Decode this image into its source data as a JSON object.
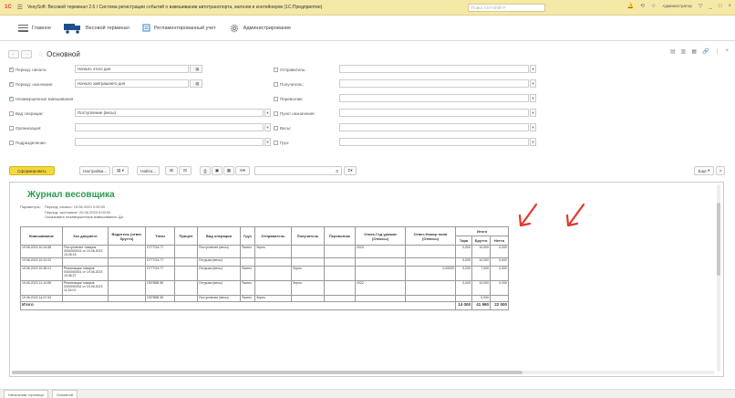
{
  "titlebar": {
    "logo": "1С",
    "title": "VesySoft: Весовой терминал 2.6 / Система регистрации событий о взвешивании автотранспорта, вагонов и контейнеров (1С:Предприятие)",
    "search_placeholder": "Поиск Ctrl+Shift+F",
    "user": "Администратор"
  },
  "nav": {
    "items": [
      {
        "label": "Главное",
        "icon": "menu-icon"
      },
      {
        "label": "Весовой терминал",
        "icon": "truck-icon"
      },
      {
        "label": "Регламентированный учет",
        "icon": "ledger-icon"
      },
      {
        "label": "Администрирование",
        "icon": "gear-icon"
      }
    ]
  },
  "window": {
    "title": "Основной"
  },
  "form": {
    "left": [
      {
        "label": "Период: начало:",
        "checked": true,
        "value": "Начало этого дня"
      },
      {
        "label": "Период: окончание:",
        "checked": true,
        "value": "Начало завтрашнего дня"
      },
      {
        "label": "Незавершенные взвешивания",
        "checked": true,
        "value": ""
      },
      {
        "label": "Вид операции:",
        "checked": false,
        "value": "Поступление (весы)"
      },
      {
        "label": "Организация:",
        "checked": false,
        "value": ""
      },
      {
        "label": "Подразделение:",
        "checked": false,
        "value": ""
      }
    ],
    "right": [
      {
        "label": "Отправитель:",
        "checked": false
      },
      {
        "label": "Получатель:",
        "checked": false
      },
      {
        "label": "Перевозчик:",
        "checked": false
      },
      {
        "label": "Пункт назначения:",
        "checked": false
      },
      {
        "label": "Весы:",
        "checked": false
      },
      {
        "label": "Груз:",
        "checked": false
      }
    ]
  },
  "toolbar": {
    "generate": "Сформировать",
    "settings": "Настройки...",
    "find": "Найти...",
    "sum_value": "0",
    "more": "Еще"
  },
  "report": {
    "title": "Журнал весовщика",
    "params_label": "Параметры:",
    "params": [
      "Период: начало: 19.06.2023 0:00:00",
      "Период: окончание: 20.06.2023 0:00:00",
      "Показывать незавершенные взвешивания: Да"
    ],
    "headers": [
      "Взвешивание",
      "Хоз документ",
      "Водитель (отвес брутто)",
      "Тягач",
      "Прицеп",
      "Вид операции",
      "Груз",
      "Отправитель",
      "Получатель",
      "Перевозчик",
      "Отвес.Год урожая (Отвесы)",
      "Отвес.Номер поля (Отвесы)",
      "Итого"
    ],
    "subheaders": [
      "Тара",
      "Брутто",
      "Нетто"
    ],
    "rows": [
      {
        "c": [
          "19.06.2023 10:24:58",
          "Поступление товаров 0000000001 от 19.06.2023 10:26:15",
          "",
          "О777ОА 77",
          "",
          "Поступление (весы)",
          "Пшено",
          "Зерно",
          "",
          "",
          "2023",
          "",
          "0,000",
          "10,000",
          "0,000"
        ]
      },
      {
        "c": [
          "19.06.2023 10:31:02",
          "",
          "",
          "О777ОА 77",
          "",
          "Отгрузка (весы)",
          "",
          "",
          "",
          "",
          "",
          "",
          "0,000",
          "10,000",
          "0,000"
        ]
      },
      {
        "c": [
          "19.06.2023 10:36:01",
          "Реализация товаров 0000000001 от 19.06.2023 10:36:27",
          "",
          "О777ОА 77",
          "",
          "Отгрузка (весы)",
          "Пшено",
          "",
          "Зерно",
          "",
          "",
          "0,00000",
          "0,000",
          "7,000",
          "0,000"
        ]
      },
      {
        "c": [
          "19.06.2023 11:14:55",
          "Реализация товаров 0000000002 от 19.06.2023 11:15:01",
          "",
          "О575ВВ 55",
          "",
          "Отгрузка (весы)",
          "Пшено",
          "",
          "Зерно",
          "",
          "2022",
          "",
          "0,000",
          "10,000",
          "0,000"
        ]
      },
      {
        "c": [
          "19.06.2023 14:07:54",
          "",
          "",
          "О575ВВ 55",
          "",
          "Поступление (весы)",
          "Пшено",
          "Зерно",
          "",
          "",
          "",
          "",
          "",
          "0,000",
          ""
        ]
      }
    ],
    "total_label": "Итого",
    "totals": [
      "14 000",
      "41 990",
      "22 000"
    ]
  },
  "bottom_tabs": [
    "Начальная страница",
    "Основной"
  ]
}
